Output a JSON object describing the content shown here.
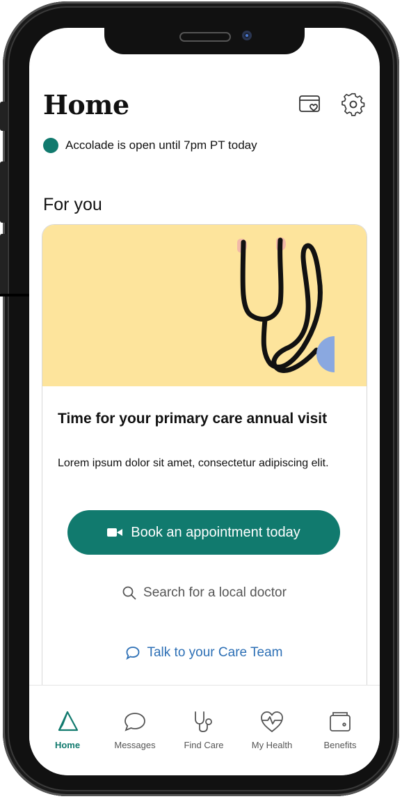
{
  "header": {
    "title": "Home",
    "icons": [
      "card-heart-icon",
      "gear-icon"
    ]
  },
  "status": {
    "text": "Accolade is open until 7pm PT today",
    "dot_color": "#117a6e"
  },
  "section": {
    "title": "For you"
  },
  "card": {
    "hero_color": "#fde49c",
    "hero_icon": "stethoscope-illustration",
    "title": "Time for your primary care annual visit",
    "body": "Lorem ipsum dolor sit amet, consectetur adipiscing elit.",
    "primary_button": "Book an appointment today",
    "search_link": "Search for a local doctor",
    "talk_link": "Talk to your Care Team"
  },
  "nav": {
    "active": "Home",
    "items": [
      {
        "label": "Home",
        "icon": "home-triangle-icon"
      },
      {
        "label": "Messages",
        "icon": "chat-bubble-icon"
      },
      {
        "label": "Find Care",
        "icon": "stethoscope-icon"
      },
      {
        "label": "My Health",
        "icon": "heartbeat-icon"
      },
      {
        "label": "Benefits",
        "icon": "wallet-icon"
      }
    ]
  },
  "colors": {
    "brand": "#117a6e",
    "link": "#2c6fb5",
    "text": "#111111",
    "muted": "#555555"
  }
}
